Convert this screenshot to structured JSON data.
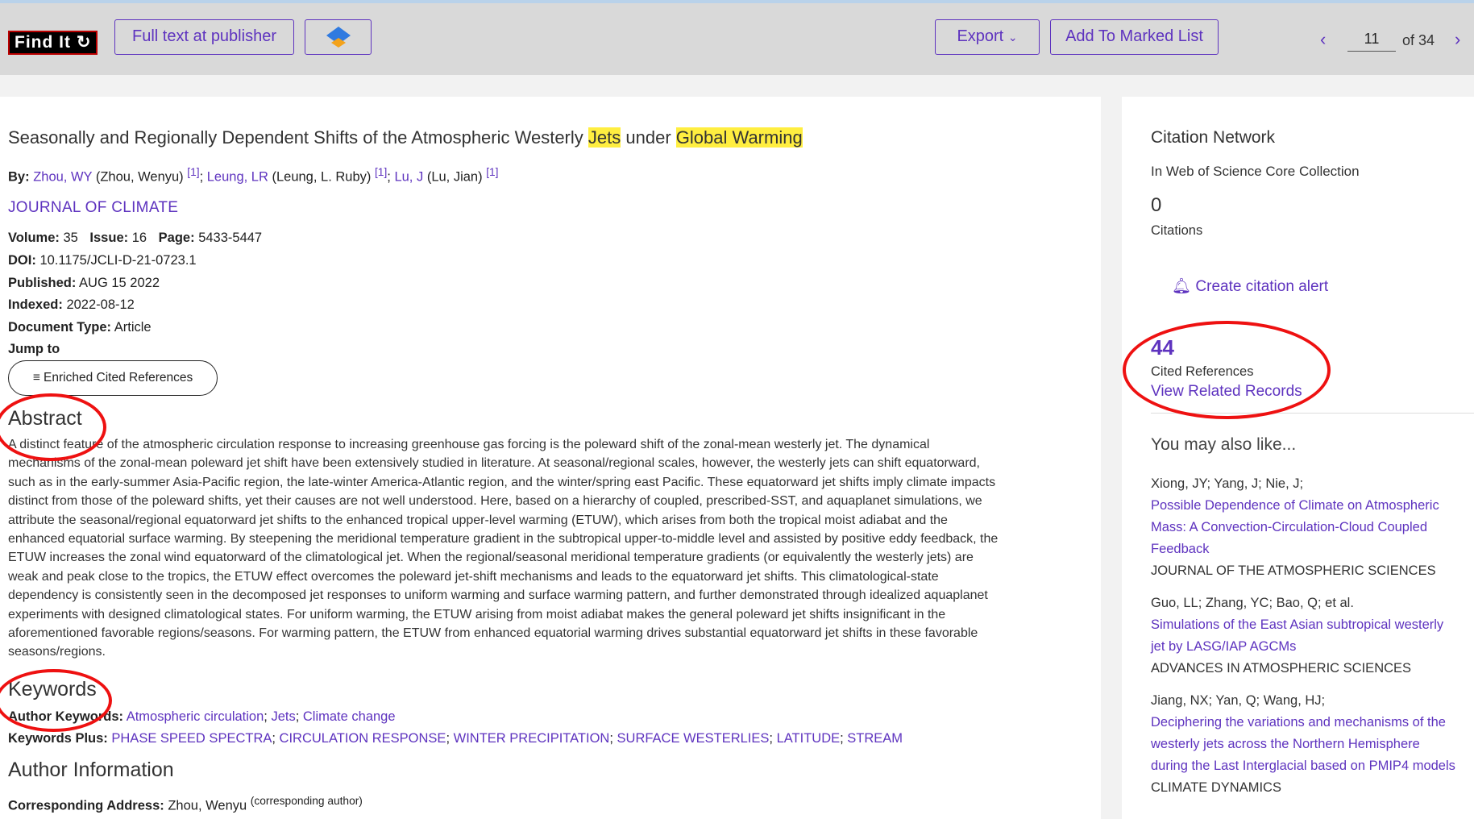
{
  "toolbar": {
    "findit_label": "Find It",
    "fulltext_label": "Full text at publisher",
    "export_label": "Export",
    "marked_list_label": "Add To Marked List",
    "page_current": "11",
    "page_total": "of 34"
  },
  "article": {
    "title_pre": "Seasonally and Regionally Dependent Shifts of the Atmospheric Westerly",
    "title_hl1": "Jets",
    "title_mid": "under",
    "title_hl2": "Global Warming",
    "by_label": "By:",
    "authors": [
      {
        "link": "Zhou, WY",
        "full": "(Zhou, Wenyu)",
        "ref": "[1]"
      },
      {
        "link": "Leung, LR",
        "full": "(Leung, L. Ruby)",
        "ref": "[1]"
      },
      {
        "link": "Lu, J",
        "full": "(Lu, Jian)",
        "ref": "[1]"
      }
    ],
    "journal": "JOURNAL OF CLIMATE",
    "volume_label": "Volume:",
    "volume": "35",
    "issue_label": "Issue:",
    "issue": "16",
    "page_label": "Page:",
    "page": "5433-5447",
    "doi_label": "DOI:",
    "doi": "10.1175/JCLI-D-21-0723.1",
    "published_label": "Published:",
    "published": "AUG 15 2022",
    "indexed_label": "Indexed:",
    "indexed": "2022-08-12",
    "doctype_label": "Document Type:",
    "doctype": "Article",
    "jump_label": "Jump to",
    "enriched_label": "Enriched Cited References",
    "abstract_heading": "Abstract",
    "abstract_lines": [
      "A distinct feature of the atmospheric circulation response to increasing greenhouse gas forcing is the poleward shift of the zonal-mean westerly jet. The dynamical",
      "mechanisms of the zonal-mean poleward jet shift have been extensively studied in literature. At seasonal/regional scales, however, the westerly jets can shift equatorward,",
      "such as in the early-summer Asia-Pacific region, the late-winter America-Atlantic region, and the winter/spring east Pacific. These equatorward jet shifts imply climate impacts",
      "distinct from those of the poleward shifts, yet their causes are not well understood. Here, based on a hierarchy of coupled, prescribed-SST, and aquaplanet simulations, we",
      "attribute the seasonal/regional equatorward jet shifts to the enhanced tropical upper-level warming (ETUW), which arises from both the tropical moist adiabat and the",
      "enhanced equatorial surface warming. By steepening the meridional temperature gradient in the subtropical upper-to-middle level and assisted by positive eddy feedback, the",
      "ETUW increases the zonal wind equatorward of the climatological jet. When the regional/seasonal meridional temperature gradients (or equivalently the westerly jets) are",
      "weak and peak close to the tropics, the ETUW effect overcomes the poleward jet-shift mechanisms and leads to the equatorward jet shifts. This climatological-state",
      "dependency is consistently seen in the decomposed jet responses to uniform warming and surface warming pattern, and further demonstrated through idealized aquaplanet",
      "experiments with designed climatological states. For uniform warming, the ETUW arising from moist adiabat makes the general poleward jet shifts insignificant in the",
      "aforementioned favorable regions/seasons. For warming pattern, the ETUW from enhanced equatorial warming drives substantial equatorward jet shifts in these favorable",
      "seasons/regions."
    ],
    "keywords_heading": "Keywords",
    "author_kw_label": "Author Keywords:",
    "author_keywords": [
      "Atmospheric circulation",
      "Jets",
      "Climate change"
    ],
    "kw_plus_label": "Keywords Plus:",
    "keywords_plus": [
      "PHASE SPEED SPECTRA",
      "CIRCULATION RESPONSE",
      "WINTER PRECIPITATION",
      "SURFACE WESTERLIES",
      "LATITUDE",
      "STREAM"
    ],
    "author_info_heading": "Author Information",
    "corr_label": "Corresponding Address:",
    "corr_name": "Zhou, Wenyu",
    "corr_note": "(corresponding author)"
  },
  "sidebar": {
    "heading": "Citation Network",
    "sub": "In Web of Science Core Collection",
    "citations_count": "0",
    "citations_label": "Citations",
    "alert_label": "Create citation alert",
    "cited_count": "44",
    "cited_label": "Cited References",
    "related_label": "View Related Records",
    "also_like": "You may also like...",
    "records": [
      {
        "authors": "Xiong, JY; Yang, J; Nie, J;",
        "title_lines": [
          "Possible Dependence of Climate on Atmospheric",
          "Mass: A Convection-Circulation-Cloud Coupled",
          "Feedback"
        ],
        "journal": "JOURNAL OF THE ATMOSPHERIC SCIENCES"
      },
      {
        "authors": "Guo, LL; Zhang, YC; Bao, Q; et al.",
        "title_lines": [
          "Simulations of the East Asian subtropical westerly",
          "jet by LASG/IAP AGCMs"
        ],
        "journal": "ADVANCES IN ATMOSPHERIC SCIENCES"
      },
      {
        "authors": "Jiang, NX; Yan, Q; Wang, HJ;",
        "title_lines": [
          "Deciphering the variations and mechanisms of the",
          "westerly jets across the Northern Hemisphere",
          "during the Last Interglacial based on PMIP4 models"
        ],
        "journal": "CLIMATE DYNAMICS"
      }
    ]
  }
}
